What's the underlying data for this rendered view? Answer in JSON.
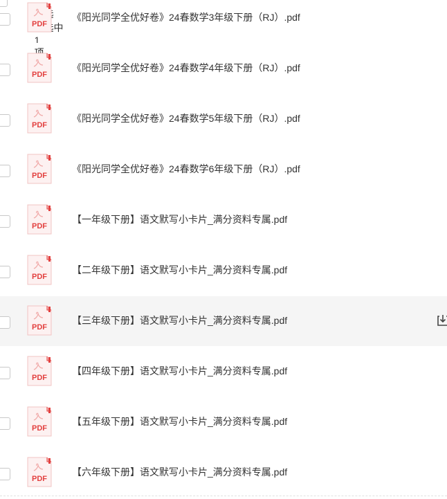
{
  "selection_bar": {
    "select_all": "全选",
    "selected_prefix": "已选中",
    "selected_count": "1",
    "selected_suffix": "项"
  },
  "files": [
    {
      "name": "《阳光同学全优好卷》24春数学3年级下册（RJ）.pdf",
      "icon": "pdf-file-icon",
      "selected": false,
      "hovered": false
    },
    {
      "name": "《阳光同学全优好卷》24春数学4年级下册（RJ）.pdf",
      "icon": "pdf-file-icon",
      "selected": false,
      "hovered": false
    },
    {
      "name": "《阳光同学全优好卷》24春数学5年级下册（RJ）.pdf",
      "icon": "pdf-file-icon",
      "selected": false,
      "hovered": false
    },
    {
      "name": "《阳光同学全优好卷》24春数学6年级下册（RJ）.pdf",
      "icon": "pdf-file-icon",
      "selected": false,
      "hovered": false
    },
    {
      "name": "【一年级下册】语文默写小卡片_满分资料专属.pdf",
      "icon": "pdf-file-icon",
      "selected": false,
      "hovered": false
    },
    {
      "name": "【二年级下册】语文默写小卡片_满分资料专属.pdf",
      "icon": "pdf-file-icon",
      "selected": false,
      "hovered": false
    },
    {
      "name": "【三年级下册】语文默写小卡片_满分资料专属.pdf",
      "icon": "pdf-file-icon",
      "selected": false,
      "hovered": true
    },
    {
      "name": "【四年级下册】语文默写小卡片_满分资料专属.pdf",
      "icon": "pdf-file-icon",
      "selected": false,
      "hovered": false
    },
    {
      "name": "【五年级下册】语文默写小卡片_满分资料专属.pdf",
      "icon": "pdf-file-icon",
      "selected": false,
      "hovered": false
    },
    {
      "name": "【六年级下册】语文默写小卡片_满分资料专属.pdf",
      "icon": "pdf-file-icon",
      "selected": false,
      "hovered": false
    }
  ],
  "icon_labels": {
    "pdf": "PDF"
  },
  "colors": {
    "pdf_red": "#e2403f",
    "pdf_light": "#f7d7d6",
    "hover_bg": "#f5f5f5",
    "text": "#333333"
  }
}
